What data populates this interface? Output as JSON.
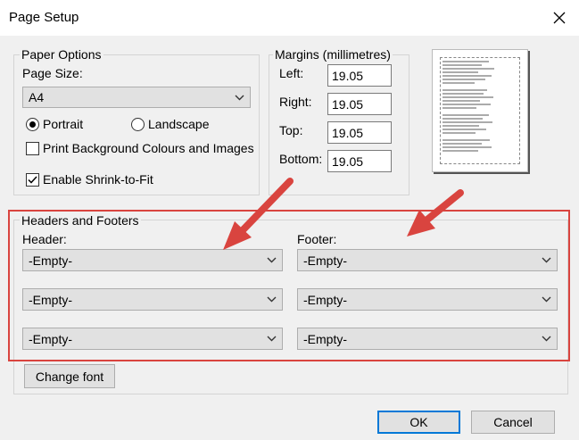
{
  "window": {
    "title": "Page Setup"
  },
  "paper_options": {
    "group_title": "Paper Options",
    "page_size_label": "Page Size:",
    "page_size_value": "A4",
    "portrait_label": "Portrait",
    "landscape_label": "Landscape",
    "orientation": "Portrait",
    "print_background_label": "Print Background Colours and Images",
    "print_background_checked": false,
    "shrink_label": "Enable Shrink-to-Fit",
    "shrink_checked": true
  },
  "margins": {
    "group_title": "Margins (millimetres)",
    "left_label": "Left:",
    "left_value": "19.05",
    "right_label": "Right:",
    "right_value": "19.05",
    "top_label": "Top:",
    "top_value": "19.05",
    "bottom_label": "Bottom:",
    "bottom_value": "19.05"
  },
  "headers_footers": {
    "group_title": "Headers and Footers",
    "header_label": "Header:",
    "footer_label": "Footer:",
    "header_values": [
      "-Empty-",
      "-Empty-",
      "-Empty-"
    ],
    "footer_values": [
      "-Empty-",
      "-Empty-",
      "-Empty-"
    ],
    "change_font_label": "Change font"
  },
  "buttons": {
    "ok": "OK",
    "cancel": "Cancel"
  },
  "colors": {
    "highlight": "#d9443f",
    "accent": "#0078d7"
  }
}
